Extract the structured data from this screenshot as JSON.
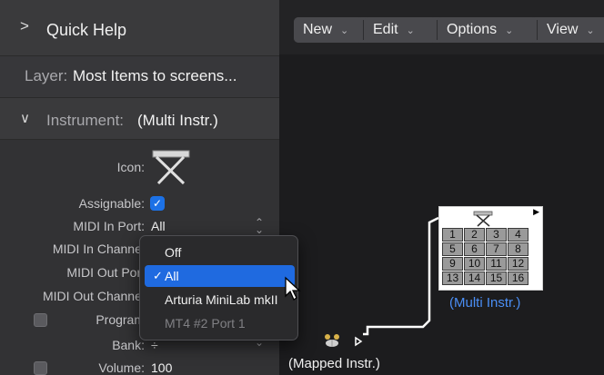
{
  "inspector": {
    "quick_help": {
      "chevron": ">",
      "label": "Quick Help"
    },
    "layer": {
      "key": "Layer:",
      "value": "Most Items to screens..."
    },
    "instrument": {
      "chevron": "∨",
      "key": "Instrument:",
      "value": "(Multi Instr.)"
    },
    "params": {
      "icon_label": "Icon:",
      "assignable_label": "Assignable:",
      "midi_in_port_label": "MIDI In Port:",
      "midi_in_port_value": "All",
      "midi_in_channel_label": "MIDI In Channel",
      "midi_out_port_label": "MIDI Out Port",
      "midi_out_channel_label": "MIDI Out Channel",
      "program_label": "Program",
      "bank_label": "Bank:",
      "bank_value": "÷",
      "volume_label": "Volume:",
      "volume_value": "100"
    }
  },
  "toolbar": {
    "new_label": "New",
    "edit_label": "Edit",
    "options_label": "Options",
    "view_label": "View"
  },
  "popup": {
    "items": [
      {
        "label": "Off",
        "selected": false,
        "disabled": false
      },
      {
        "label": "All",
        "selected": true,
        "disabled": false
      },
      {
        "label": "Arturia MiniLab mkII",
        "selected": false,
        "disabled": false
      },
      {
        "label": "MT4 #2 Port 1",
        "selected": false,
        "disabled": true
      }
    ],
    "check_glyph": "✓"
  },
  "canvas": {
    "multi_instr_cells": [
      "1",
      "2",
      "3",
      "4",
      "5",
      "6",
      "7",
      "8",
      "9",
      "10",
      "11",
      "12",
      "13",
      "14",
      "15",
      "16"
    ],
    "multi_instr_label": "(Multi Instr.)",
    "mapped_instr_label": "(Mapped Instr.)"
  },
  "colors": {
    "accent": "#1f6ae0",
    "link": "#4a8ef5"
  }
}
